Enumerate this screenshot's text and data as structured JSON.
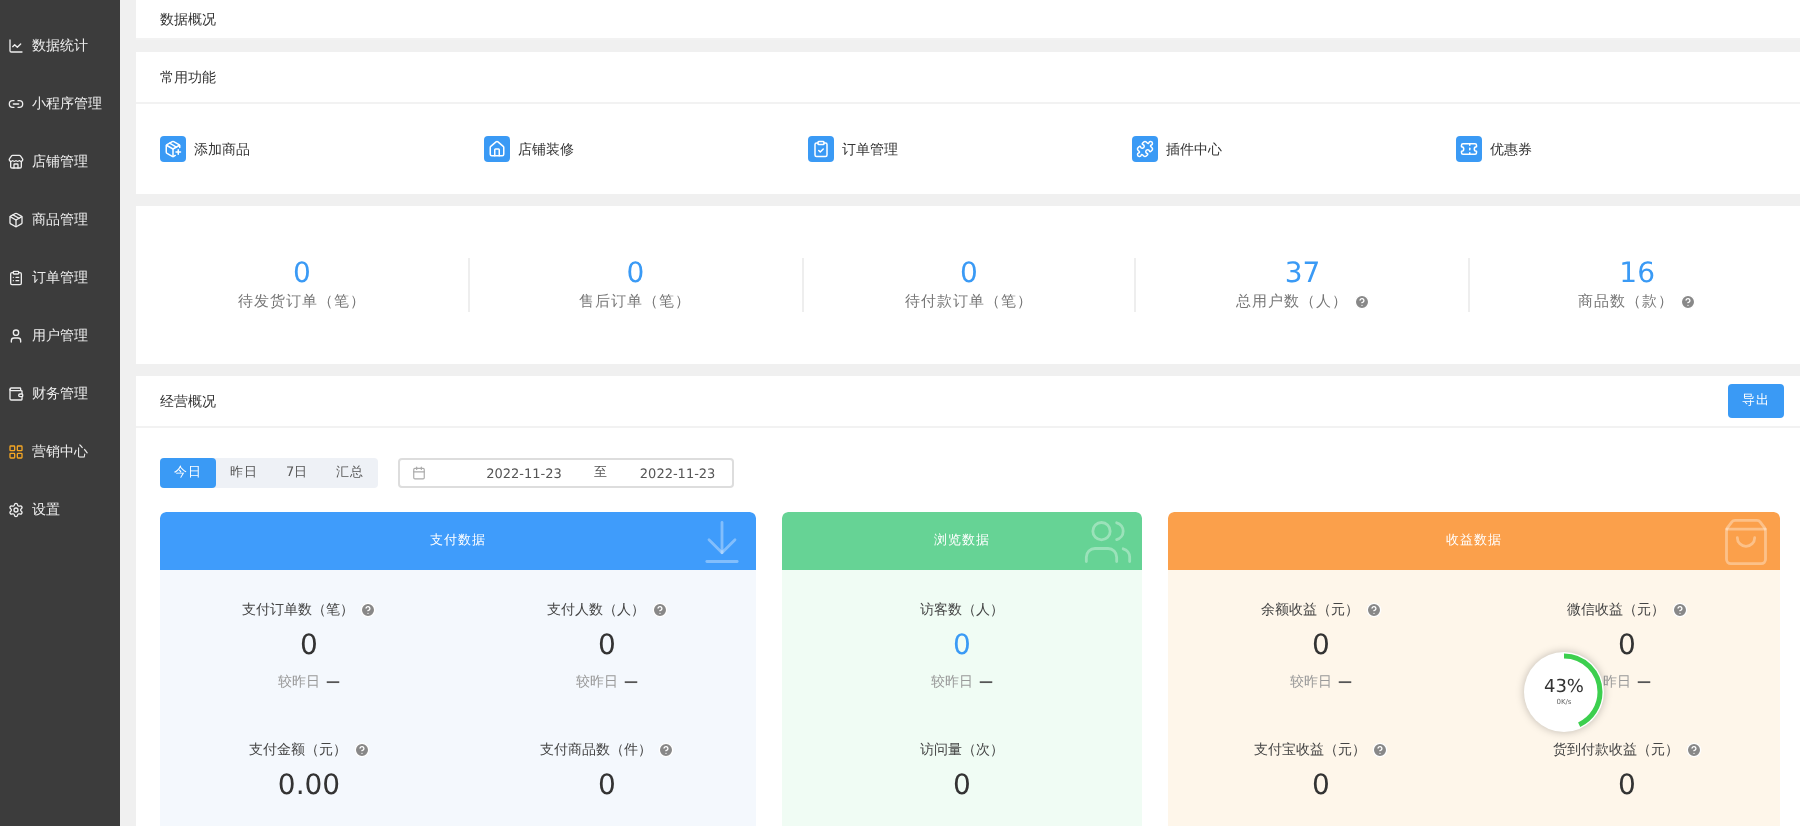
{
  "sidebar": {
    "items": [
      {
        "label": "数据统计",
        "kind": "chart"
      },
      {
        "label": "小程序管理",
        "kind": "link"
      },
      {
        "label": "店铺管理",
        "kind": "store"
      },
      {
        "label": "商品管理",
        "kind": "goods"
      },
      {
        "label": "订单管理",
        "kind": "order"
      },
      {
        "label": "用户管理",
        "kind": "user"
      },
      {
        "label": "财务管理",
        "kind": "finance"
      },
      {
        "label": "营销中心",
        "kind": "marketing"
      },
      {
        "label": "设置",
        "kind": "settings"
      }
    ]
  },
  "overview_title": "数据概况",
  "quick_functions": {
    "title": "常用功能",
    "items": [
      {
        "label": "添加商品",
        "kind": "add"
      },
      {
        "label": "店铺装修",
        "kind": "home"
      },
      {
        "label": "订单管理",
        "kind": "order"
      },
      {
        "label": "插件中心",
        "kind": "plugin"
      },
      {
        "label": "优惠券",
        "kind": "coupon"
      }
    ]
  },
  "stats": [
    {
      "value": "0",
      "label": "待发货订单（笔）",
      "help": false
    },
    {
      "value": "0",
      "label": "售后订单（笔）",
      "help": false
    },
    {
      "value": "0",
      "label": "待付款订单（笔）",
      "help": false
    },
    {
      "value": "37",
      "label": "总用户数（人）",
      "help": true
    },
    {
      "value": "16",
      "label": "商品数（款）",
      "help": true
    }
  ],
  "business": {
    "title": "经营概况",
    "export_button": "导出",
    "tabs": [
      {
        "label": "今日",
        "selected": true
      },
      {
        "label": "昨日",
        "selected": false
      },
      {
        "label": "7日",
        "selected": false
      },
      {
        "label": "汇总",
        "selected": false
      }
    ],
    "date_range": {
      "start": "2022-11-23",
      "separator": "至",
      "end": "2022-11-23"
    },
    "cards": [
      {
        "kind": "pay",
        "title": "支付数据",
        "metrics": [
          {
            "label": "支付订单数（笔）",
            "help": true,
            "value": "0",
            "highlight": false,
            "compare": "较昨日",
            "trend": "—"
          },
          {
            "label": "支付人数（人）",
            "help": true,
            "value": "0",
            "highlight": false,
            "compare": "较昨日",
            "trend": "—"
          },
          {
            "label": "支付金额（元）",
            "help": true,
            "value": "0.00",
            "highlight": false
          },
          {
            "label": "支付商品数（件）",
            "help": true,
            "value": "0",
            "highlight": false
          }
        ]
      },
      {
        "kind": "view",
        "title": "浏览数据",
        "metrics": [
          {
            "label": "访客数（人）",
            "help": false,
            "value": "0",
            "highlight": true,
            "compare": "较昨日",
            "trend": "—"
          },
          {
            "label": "访问量（次）",
            "help": false,
            "value": "0",
            "highlight": false
          }
        ]
      },
      {
        "kind": "income",
        "title": "收益数据",
        "metrics": [
          {
            "label": "余额收益（元）",
            "help": true,
            "value": "0",
            "highlight": false,
            "compare": "较昨日",
            "trend": "—"
          },
          {
            "label": "微信收益（元）",
            "help": true,
            "value": "0",
            "highlight": false,
            "compare": "昨日",
            "trend": "—"
          },
          {
            "label": "支付宝收益（元）",
            "help": true,
            "value": "0",
            "highlight": false
          },
          {
            "label": "货到付款收益（元）",
            "help": true,
            "value": "0",
            "highlight": false
          }
        ]
      }
    ]
  },
  "speed_widget": {
    "percent": "43%",
    "level": 0.43,
    "rate": "0K/s"
  }
}
